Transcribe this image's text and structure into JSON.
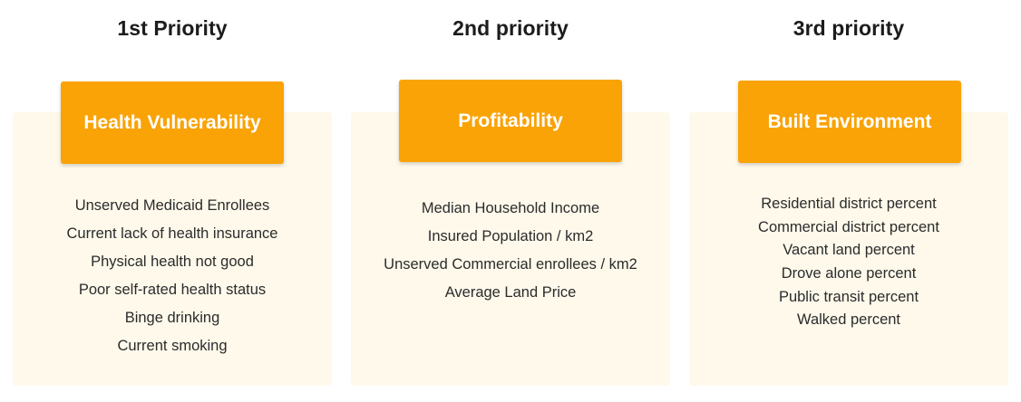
{
  "priorities": [
    {
      "title": "1st Priority",
      "label": "Health Vulnerability",
      "items": [
        "Unserved Medicaid Enrollees",
        "Current lack of health insurance",
        "Physical health not good",
        "Poor self-rated health status",
        "Binge drinking",
        "Current smoking"
      ]
    },
    {
      "title": "2nd priority",
      "label": "Profitability",
      "items": [
        "Median Household Income",
        "Insured Population / km2",
        "Unserved Commercial enrollees / km2",
        "Average Land Price"
      ]
    },
    {
      "title": "3rd priority",
      "label": "Built Environment",
      "items": [
        "Residential district percent",
        "Commercial district percent",
        "Vacant land percent",
        "Drove alone percent",
        "Public transit percent",
        "Walked percent"
      ]
    }
  ],
  "colors": {
    "accent": "#f9a307",
    "card_background": "#fef9eb",
    "title_text": "#1c1c1c",
    "item_text": "#2b2b2b"
  }
}
